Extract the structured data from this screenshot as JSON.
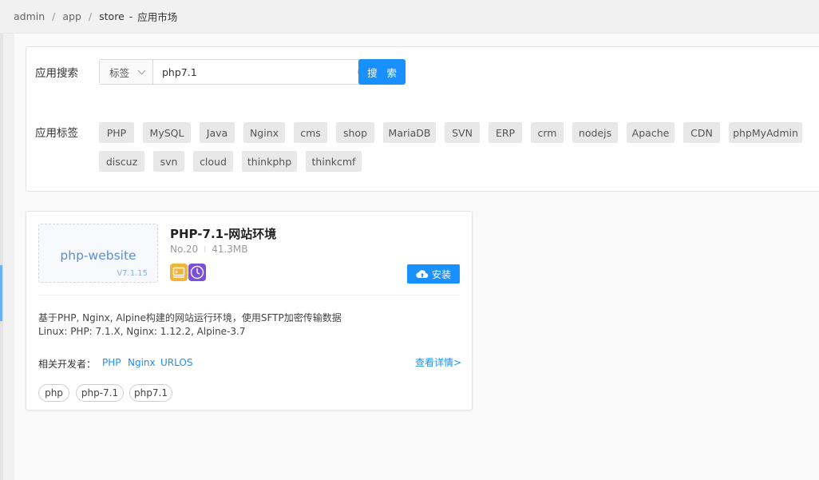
{
  "breadcrumb": {
    "items": [
      "admin",
      "app",
      "store"
    ],
    "separator": "/",
    "dash": "-",
    "current": "应用市场"
  },
  "search": {
    "label": "应用搜索",
    "select_value": "标签",
    "input_value": "php7.1",
    "button_label": "搜 索"
  },
  "tags": {
    "label": "应用标签",
    "items": [
      "PHP",
      "MySQL",
      "Java",
      "Nginx",
      "cms",
      "shop",
      "MariaDB",
      "SVN",
      "ERP",
      "crm",
      "nodejs",
      "Apache",
      "CDN",
      "phpMyAdmin",
      "discuz",
      "svn",
      "cloud",
      "thinkphp",
      "thinkcmf"
    ]
  },
  "app": {
    "logo_text": "php-website",
    "logo_version": "V7.1.15",
    "title": "PHP-7.1-网站环境",
    "number": "No.20",
    "size": "41.3MB",
    "install_label": "安装",
    "description_1": "基于PHP, Nginx, Alpine构建的网站运行环境，使用SFTP加密传输数据",
    "description_2": "Linux: PHP: 7.1.X, Nginx: 1.12.2, Alpine-3.7",
    "developers_label": "相关开发者：",
    "developers": [
      "PHP",
      "Nginx",
      "URLOS"
    ],
    "detail_link": "查看详情>",
    "keywords": [
      "php",
      "php-7.1",
      "php7.1"
    ]
  },
  "colors": {
    "accent": "#1890ff",
    "badge_yellow": "#f0b43c",
    "badge_purple": "#7b4fd8"
  },
  "icons": {
    "clear": "clear-circle-icon",
    "dropdown": "chevron-down-icon",
    "install": "cloud-upload-icon",
    "badge_1": "terminal-badge-icon",
    "badge_2": "power-badge-icon"
  }
}
